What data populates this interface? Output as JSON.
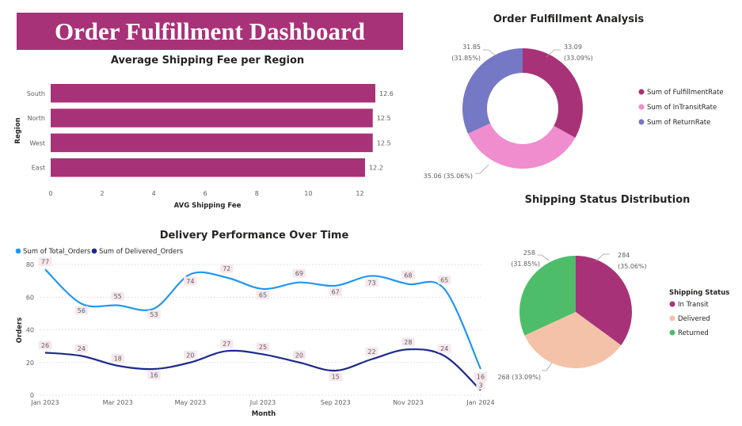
{
  "header": {
    "title": "Order Fulfillment Dashboard"
  },
  "colors": {
    "magenta": "#a83277",
    "pink": "#ef8dce",
    "violet": "#7478c5",
    "lightblue": "#2196f3",
    "navy": "#1d2a8f",
    "peach": "#f4c2a8",
    "green": "#4dbd6a"
  },
  "chart_data": [
    {
      "type": "bar",
      "orientation": "horizontal",
      "title": "Average Shipping Fee per Region",
      "xlabel": "AVG Shipping Fee",
      "ylabel": "Region",
      "categories": [
        "South",
        "North",
        "West",
        "East"
      ],
      "values": [
        12.6,
        12.5,
        12.5,
        12.2
      ],
      "value_labels": [
        "12.6",
        "12.5",
        "12.5",
        "12.2"
      ],
      "xlim": [
        0,
        13
      ],
      "xticks": [
        "0",
        "2",
        "4",
        "6",
        "8",
        "10",
        "12"
      ]
    },
    {
      "type": "pie",
      "variant": "donut",
      "title": "Order Fulfillment Analysis",
      "legend_position": "right",
      "slices": [
        {
          "name": "Sum of FulfillmentRate",
          "value": 33.09,
          "label": "33.09",
          "pct_label": "(33.09%)"
        },
        {
          "name": "Sum of InTransitRate",
          "value": 35.06,
          "label": "35.06 (35.06%)",
          "pct_label": ""
        },
        {
          "name": "Sum of ReturnRate",
          "value": 31.85,
          "label": "31.85",
          "pct_label": "(31.85%)"
        }
      ]
    },
    {
      "type": "line",
      "title": "Delivery Performance Over Time",
      "xlabel": "Month",
      "ylabel": "Orders",
      "legend_position": "top-left",
      "ylim": [
        0,
        80
      ],
      "yticks": [
        "0",
        "20",
        "40",
        "60",
        "80"
      ],
      "x": [
        "Jan 2023",
        "Feb 2023",
        "Mar 2023",
        "Apr 2023",
        "May 2023",
        "Jun 2023",
        "Jul 2023",
        "Aug 2023",
        "Sep 2023",
        "Oct 2023",
        "Nov 2023",
        "Dec 2023",
        "Jan 2024"
      ],
      "xticks": [
        "Jan 2023",
        "Mar 2023",
        "May 2023",
        "Jul 2023",
        "Sep 2023",
        "Nov 2023",
        "Jan 2024"
      ],
      "series": [
        {
          "name": "Sum of Total_Orders",
          "values": [
            77,
            56,
            55,
            53,
            74,
            72,
            65,
            69,
            67,
            73,
            68,
            65,
            16
          ]
        },
        {
          "name": "Sum of Delivered_Orders",
          "values": [
            26,
            24,
            18,
            16,
            20,
            27,
            25,
            20,
            15,
            22,
            28,
            24,
            3
          ]
        }
      ]
    },
    {
      "type": "pie",
      "title": "Shipping Status Distribution",
      "legend_title": "Shipping Status",
      "legend_position": "right",
      "slices": [
        {
          "name": "In Transit",
          "value": 284,
          "label": "284",
          "pct_label": "(35.06%)"
        },
        {
          "name": "Delivered",
          "value": 268,
          "label": "268 (33.09%)",
          "pct_label": ""
        },
        {
          "name": "Returned",
          "value": 258,
          "label": "258",
          "pct_label": "(31.85%)"
        }
      ]
    }
  ]
}
